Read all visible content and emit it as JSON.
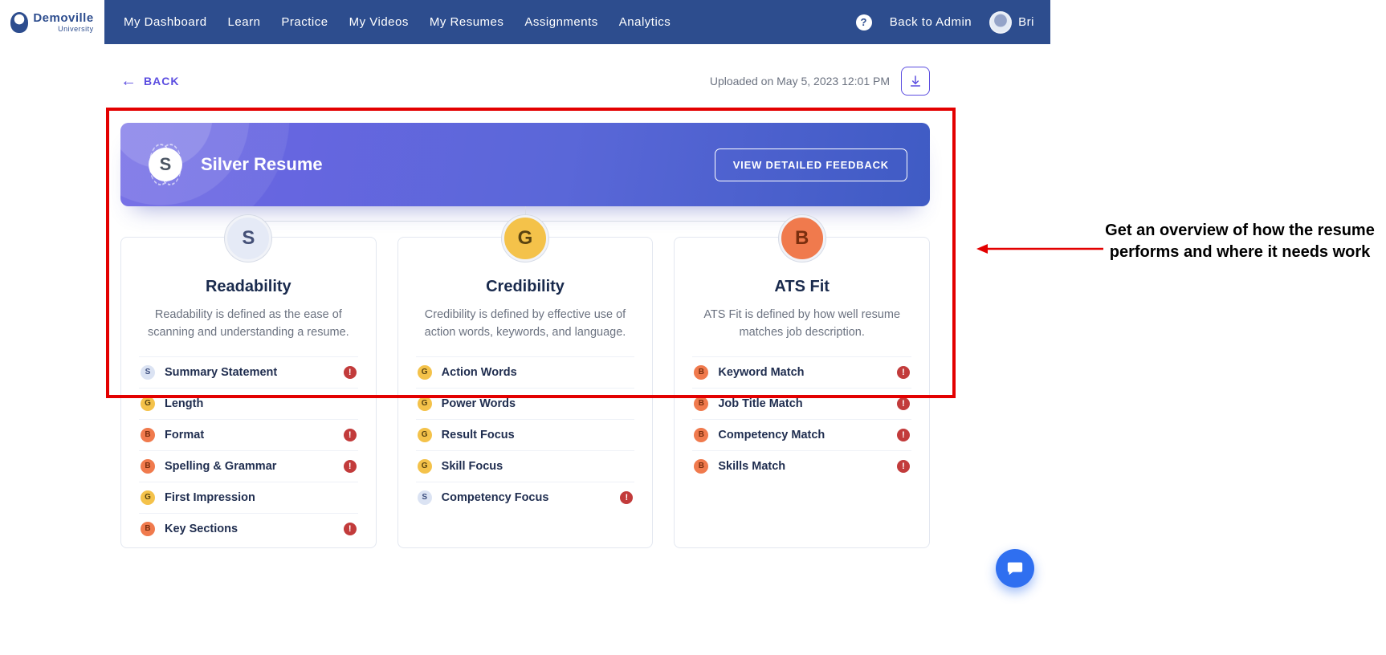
{
  "brand": {
    "name": "Demoville",
    "subtitle": "University"
  },
  "nav": {
    "items": [
      "My Dashboard",
      "Learn",
      "Practice",
      "My Videos",
      "My Resumes",
      "Assignments",
      "Analytics"
    ],
    "help": "?",
    "back_admin": "Back to Admin",
    "user": "Bri"
  },
  "subheader": {
    "back": "BACK",
    "uploaded": "Uploaded on May 5, 2023 12:01 PM"
  },
  "hero": {
    "grade": "S",
    "title": "Silver Resume",
    "cta": "VIEW DETAILED FEEDBACK"
  },
  "cards": [
    {
      "grade": "S",
      "title": "Readability",
      "desc": "Readability is defined as the ease of scanning and understanding a resume.",
      "items": [
        {
          "grade": "S",
          "label": "Summary Statement",
          "warn": true
        },
        {
          "grade": "G",
          "label": "Length",
          "warn": false
        },
        {
          "grade": "B",
          "label": "Format",
          "warn": true
        },
        {
          "grade": "B",
          "label": "Spelling & Grammar",
          "warn": true
        },
        {
          "grade": "G",
          "label": "First Impression",
          "warn": false
        },
        {
          "grade": "B",
          "label": "Key Sections",
          "warn": true
        }
      ]
    },
    {
      "grade": "G",
      "title": "Credibility",
      "desc": "Credibility is defined by effective use of action words, keywords, and language.",
      "items": [
        {
          "grade": "G",
          "label": "Action Words",
          "warn": false
        },
        {
          "grade": "G",
          "label": "Power Words",
          "warn": false
        },
        {
          "grade": "G",
          "label": "Result Focus",
          "warn": false
        },
        {
          "grade": "G",
          "label": "Skill Focus",
          "warn": false
        },
        {
          "grade": "S",
          "label": "Competency Focus",
          "warn": true
        }
      ]
    },
    {
      "grade": "B",
      "title": "ATS Fit",
      "desc": "ATS Fit is defined by how well resume matches job description.",
      "items": [
        {
          "grade": "B",
          "label": "Keyword Match",
          "warn": true
        },
        {
          "grade": "B",
          "label": "Job Title Match",
          "warn": true
        },
        {
          "grade": "B",
          "label": "Competency Match",
          "warn": true
        },
        {
          "grade": "B",
          "label": "Skills Match",
          "warn": true
        }
      ]
    }
  ],
  "annotation": "Get an overview of how the resume performs and where it needs work",
  "colors": {
    "navbar": "#2d4d8e",
    "accent": "#5b4de0",
    "grade_S": "#e5eaf6",
    "grade_G": "#f4c24a",
    "grade_B": "#f07a4d",
    "warn": "#c23b3b",
    "annotation_red": "#e30000",
    "chat_fab": "#2f6ff0"
  }
}
